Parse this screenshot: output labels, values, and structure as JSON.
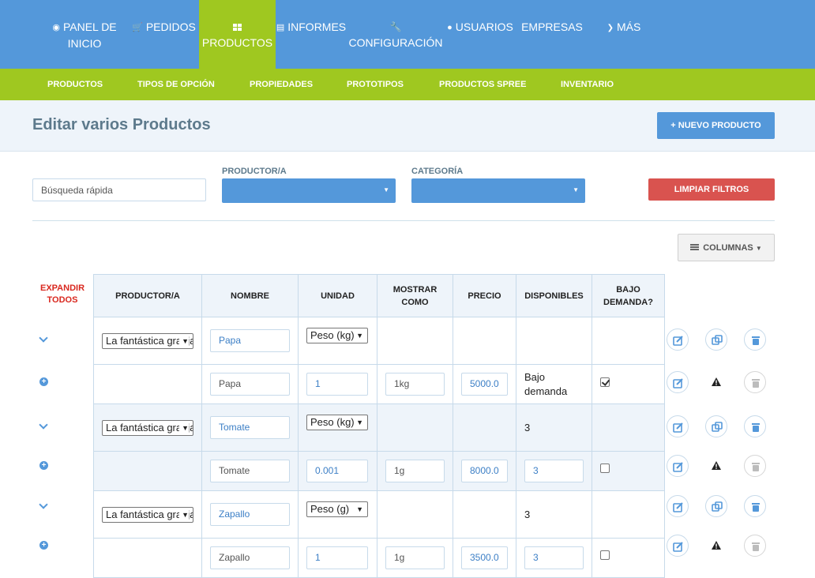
{
  "nav": {
    "items": [
      {
        "label": "PANEL DE INICIO",
        "icon": "dashboard-icon"
      },
      {
        "label": "PEDIDOS",
        "icon": "cart-icon"
      },
      {
        "label": "PRODUCTOS",
        "icon": "grid-icon",
        "active": true
      },
      {
        "label": "INFORMES",
        "icon": "file-icon"
      },
      {
        "label": "CONFIGURACIÓN",
        "icon": "wrench-icon"
      },
      {
        "label": "USUARIOS",
        "icon": "user-icon"
      },
      {
        "label": "EMPRESAS"
      },
      {
        "label": "MÁS",
        "icon": "chevron-down-icon"
      }
    ]
  },
  "subnav": {
    "items": [
      {
        "label": "PRODUCTOS",
        "active": true
      },
      {
        "label": "TIPOS DE OPCIÓN"
      },
      {
        "label": "PROPIEDADES"
      },
      {
        "label": "PROTOTIPOS"
      },
      {
        "label": "PRODUCTOS SPREE",
        "active": true
      },
      {
        "label": "INVENTARIO"
      }
    ]
  },
  "page": {
    "title": "Editar varios Productos",
    "new_button": "+ NUEVO PRODUCTO"
  },
  "filters": {
    "search_placeholder": "Búsqueda rápida",
    "producer_label": "PRODUCTOR/A",
    "category_label": "CATEGORÍA",
    "clear_button": "LIMPIAR FILTROS",
    "columns_button": "COLUMNAS"
  },
  "table": {
    "expand_all": "EXPANDIR TODOS",
    "headers": [
      "PRODUCTOR/A",
      "NOMBRE",
      "UNIDAD",
      "MOSTRAR COMO",
      "PRECIO",
      "DISPONIBLES",
      "BAJO DEMANDA?"
    ],
    "products": [
      {
        "producer": "La fantástica granja",
        "name": "Papa",
        "unit": "Peso (kg)",
        "available": "",
        "variant": {
          "name": "Papa",
          "unit_value": "1",
          "display_as": "1kg",
          "price": "5000.0",
          "available_text": "Bajo demanda",
          "on_demand": true
        }
      },
      {
        "producer": "La fantástica granja",
        "name": "Tomate",
        "unit": "Peso (kg)",
        "available": "3",
        "variant": {
          "name": "Tomate",
          "unit_value": "0.001",
          "display_as": "1g",
          "price": "8000.0",
          "available_value": "3",
          "on_demand": false
        }
      },
      {
        "producer": "La fantástica granja",
        "name": "Zapallo",
        "unit": "Peso (g)",
        "available": "3",
        "variant": {
          "name": "Zapallo",
          "unit_value": "1",
          "display_as": "1g",
          "price": "3500.0",
          "available_value": "3",
          "on_demand": false
        }
      }
    ]
  },
  "colors": {
    "nav": "#5498da",
    "subnav": "#9fc820",
    "danger": "#d9534f"
  }
}
